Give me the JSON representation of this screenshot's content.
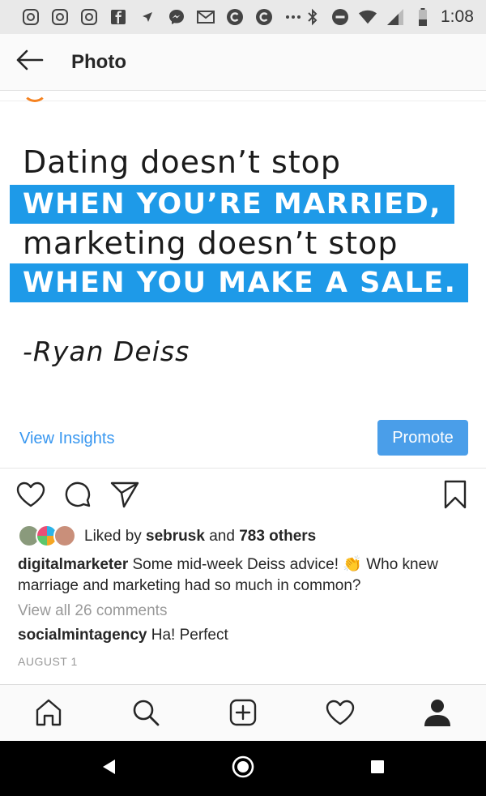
{
  "status_bar": {
    "time": "1:08",
    "left_icons": [
      "instagram-icon",
      "instagram-icon",
      "instagram-icon",
      "facebook-icon",
      "navigation-icon",
      "messenger-icon",
      "gmail-icon",
      "c-app-icon",
      "c-app-icon",
      "more-dots-icon"
    ],
    "right_icons": [
      "bluetooth-icon",
      "do-not-disturb-icon",
      "wifi-icon",
      "signal-icon",
      "battery-icon"
    ]
  },
  "header": {
    "title": "Photo"
  },
  "post_image": {
    "line1": "Dating doesn’t stop",
    "line2": "WHEN YOU’RE MARRIED,",
    "line3": "marketing doesn’t stop",
    "line4": "WHEN YOU MAKE A SALE.",
    "author": "-Ryan Deiss",
    "highlight_color": "#1e9ae8"
  },
  "insights": {
    "view_insights_label": "View Insights",
    "promote_label": "Promote"
  },
  "likes": {
    "prefix": "Liked by ",
    "user": "sebrusk",
    "middle": " and ",
    "others": "783 others"
  },
  "caption": {
    "username": "digitalmarketer",
    "text": " Some mid-week Deiss advice! 👏 Who knew marriage and marketing had so much in common?"
  },
  "comments": {
    "view_all_label": "View all 26 comments",
    "items": [
      {
        "username": "socialmintagency",
        "text": " Ha! Perfect"
      }
    ]
  },
  "post_date": "AUGUST 1",
  "bottom_nav": [
    "home-icon",
    "search-icon",
    "add-post-icon",
    "activity-heart-icon",
    "profile-icon"
  ],
  "colors": {
    "accent": "#3897f0",
    "promote_bg": "#4a9ee9"
  }
}
